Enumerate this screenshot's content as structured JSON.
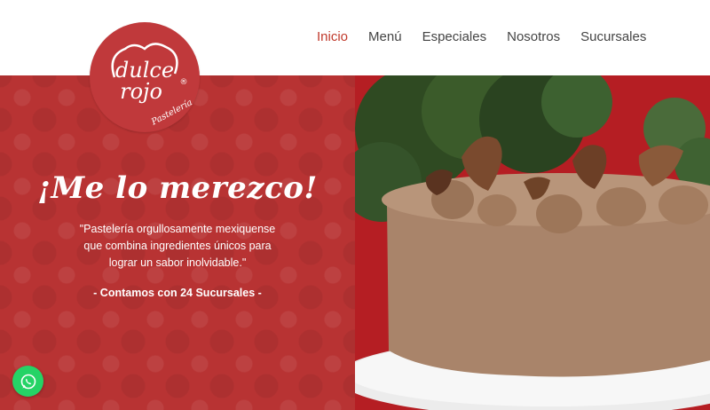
{
  "brand": {
    "logo_line1": "dulce",
    "logo_line2": "rojo",
    "logo_tagline": "Pastelería",
    "logo_registered": "®",
    "primary_color": "#b83333",
    "accent_color": "#c0392b"
  },
  "nav": {
    "items": [
      {
        "label": "Inicio",
        "active": true
      },
      {
        "label": "Menú",
        "active": false
      },
      {
        "label": "Especiales",
        "active": false
      },
      {
        "label": "Nosotros",
        "active": false
      },
      {
        "label": "Sucursales",
        "active": false
      }
    ]
  },
  "hero": {
    "headline": "¡Me lo merezco!",
    "quote": "\"Pastelería orgullosamente mexiquense que combina ingredientes únicos para lograr un sabor inolvidable.\"",
    "branches": "- Contamos con 24 Sucursales -"
  },
  "floating": {
    "icon": "whatsapp-icon",
    "color": "#25d366"
  }
}
